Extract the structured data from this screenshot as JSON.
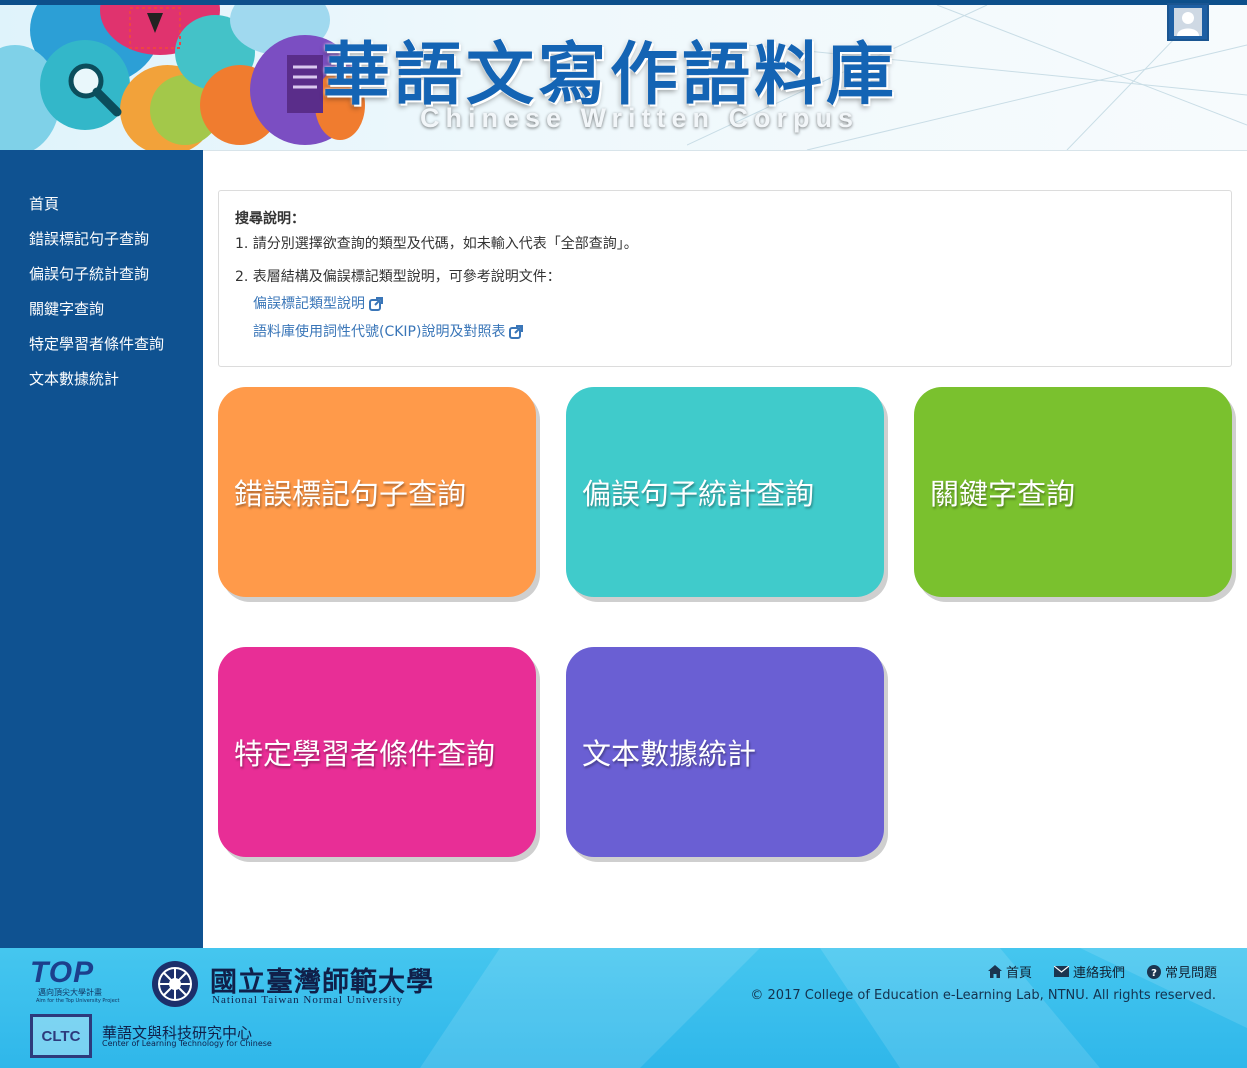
{
  "header": {
    "title_cn": "華語文寫作語料庫",
    "title_en": "Chinese Written Corpus",
    "user_icon": "user-icon"
  },
  "sidebar": {
    "items": [
      {
        "label": "首頁"
      },
      {
        "label": "錯誤標記句子查詢"
      },
      {
        "label": "偏誤句子統計查詢"
      },
      {
        "label": "關鍵字查詢"
      },
      {
        "label": "特定學習者條件查詢"
      },
      {
        "label": "文本數據統計"
      }
    ]
  },
  "info": {
    "heading": "搜尋說明：",
    "line1": "1. 請分別選擇欲查詢的類型及代碼，如未輸入代表「全部查詢」。",
    "line2": "2. 表層結構及偏誤標記類型說明，可參考說明文件：",
    "link1": "偏誤標記類型說明",
    "link2": "語料庫使用詞性代號(CKIP)說明及對照表",
    "link_icon": "external-link-icon"
  },
  "tiles": [
    {
      "label": "錯誤標記句子查詢",
      "color": "#ff9a4a"
    },
    {
      "label": "偏誤句子統計查詢",
      "color": "#40cbcb"
    },
    {
      "label": "關鍵字查詢",
      "color": "#7ac12e"
    },
    {
      "label": "特定學習者條件查詢",
      "color": "#e82e96"
    },
    {
      "label": "文本數據統計",
      "color": "#6a5fd3"
    }
  ],
  "footer": {
    "logo_top_title": "TOP",
    "logo_top_sub": "邁向頂尖大學計畫",
    "logo_top_en": "Aim for the Top University Project",
    "ntnu_cn": "國立臺灣師範大學",
    "ntnu_en": "National Taiwan Normal University",
    "clt_mark": "CLTC",
    "clt_cn": "華語文與科技研究中心",
    "clt_en": "Center of Learning Technology for Chinese",
    "links": [
      {
        "label": "首頁",
        "icon": "home-icon"
      },
      {
        "label": "連絡我們",
        "icon": "envelope-icon"
      },
      {
        "label": "常見問題",
        "icon": "question-circle-icon"
      }
    ],
    "copyright": "© 2017 College of Education e-Learning Lab, NTNU. All rights reserved."
  },
  "colors": {
    "sidebar": "#0f5291",
    "title": "#1464b4",
    "footer": "#3bbfee",
    "link": "#3a76b8"
  }
}
